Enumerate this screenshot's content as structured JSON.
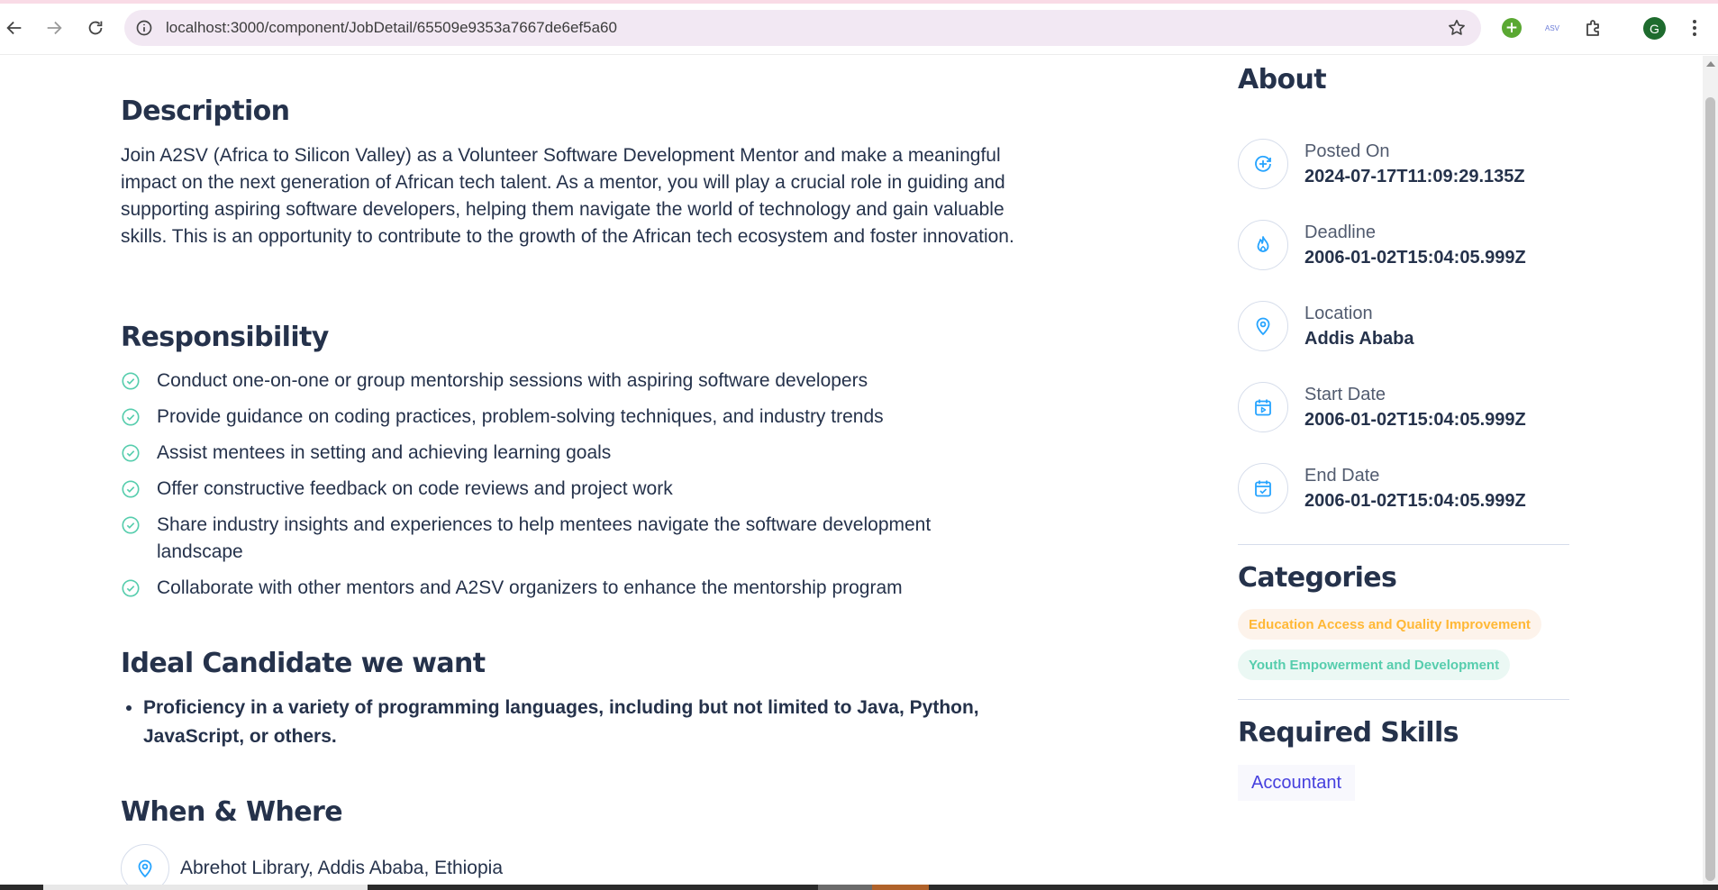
{
  "browser": {
    "url": "localhost:3000/component/JobDetail/65509e9353a7667de6ef5a60",
    "ext_mini_label": "ASV",
    "avatar_letter": "G"
  },
  "description": {
    "heading": "Description",
    "text": "Join A2SV (Africa to Silicon Valley) as a Volunteer Software Development Mentor and make a meaningful impact on the next generation of African tech talent. As a mentor, you will play a crucial role in guiding and supporting aspiring software developers, helping them navigate the world of technology and gain valuable skills. This is an opportunity to contribute to the growth of the African tech ecosystem and foster innovation."
  },
  "responsibility": {
    "heading": "Responsibility",
    "items": [
      "Conduct one-on-one or group mentorship sessions with aspiring software developers",
      "Provide guidance on coding practices, problem-solving techniques, and industry trends",
      "Assist mentees in setting and achieving learning goals",
      "Offer constructive feedback on code reviews and project work",
      "Share industry insights and experiences to help mentees navigate the software development landscape",
      "Collaborate with other mentors and A2SV organizers to enhance the mentorship program"
    ]
  },
  "ideal": {
    "heading": "Ideal Candidate we want",
    "items": [
      "Proficiency in a variety of programming languages, including but not limited to Java, Python, JavaScript, or others."
    ]
  },
  "when_where": {
    "heading": "When & Where",
    "location": "Abrehot Library, Addis Ababa, Ethiopia"
  },
  "about": {
    "heading": "About",
    "items": [
      {
        "label": "Posted On",
        "value": "2024-07-17T11:09:29.135Z",
        "icon": "plus-circle-icon"
      },
      {
        "label": "Deadline",
        "value": "2006-01-02T15:04:05.999Z",
        "icon": "fire-icon"
      },
      {
        "label": "Location",
        "value": "Addis Ababa",
        "icon": "location-pin-icon"
      },
      {
        "label": "Start Date",
        "value": "2006-01-02T15:04:05.999Z",
        "icon": "calendar-play-icon"
      },
      {
        "label": "End Date",
        "value": "2006-01-02T15:04:05.999Z",
        "icon": "calendar-check-icon"
      }
    ]
  },
  "categories": {
    "heading": "Categories",
    "items": [
      {
        "label": "Education Access and Quality Improvement",
        "color": "#ffb836"
      },
      {
        "label": "Youth Empowerment and Development",
        "color": "#56cdad"
      }
    ]
  },
  "skills": {
    "heading": "Required Skills",
    "items": [
      "Accountant"
    ]
  },
  "colors": {
    "heading": "#25324b",
    "icon_blue": "#26a4ff",
    "check_green": "#56cdad",
    "skill_text": "#4640de"
  }
}
